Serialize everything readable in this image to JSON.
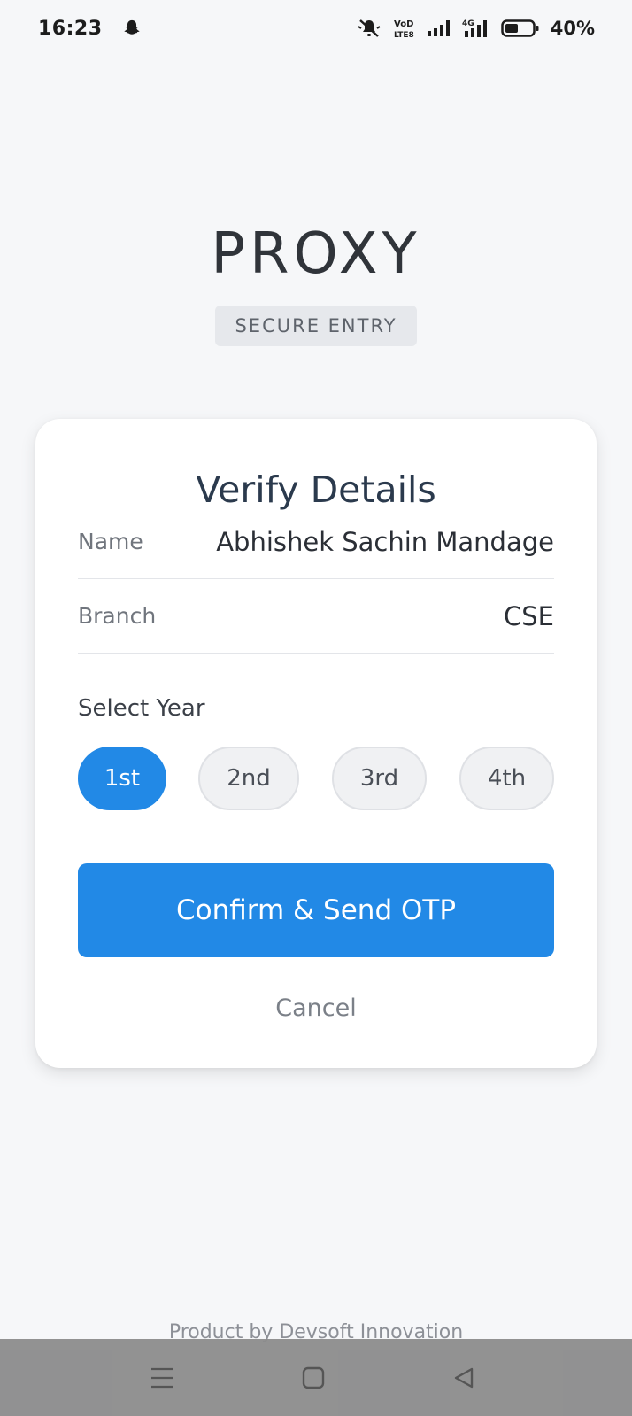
{
  "status_bar": {
    "time": "16:23",
    "battery": "40%",
    "icons": [
      "snapchat-ghost-icon",
      "mute-icon",
      "volte-icon",
      "signal-icon",
      "signal-4g-icon",
      "battery-icon"
    ]
  },
  "brand": {
    "title": "PROXY",
    "badge": "SECURE ENTRY"
  },
  "card": {
    "title": "Verify Details",
    "fields": {
      "name_label": "Name",
      "name_value": "Abhishek Sachin Mandage",
      "branch_label": "Branch",
      "branch_value": "CSE"
    },
    "year": {
      "label": "Select Year",
      "options": [
        "1st",
        "2nd",
        "3rd",
        "4th"
      ],
      "selected": "1st"
    },
    "confirm_label": "Confirm & Send OTP",
    "cancel_label": "Cancel"
  },
  "footer": "Product by Devsoft Innovation",
  "nav_bar": {
    "icons": [
      "menu-icon",
      "home-icon",
      "back-icon"
    ]
  },
  "colors": {
    "accent": "#2289e6",
    "background": "#f6f7f9",
    "card": "#ffffff"
  }
}
